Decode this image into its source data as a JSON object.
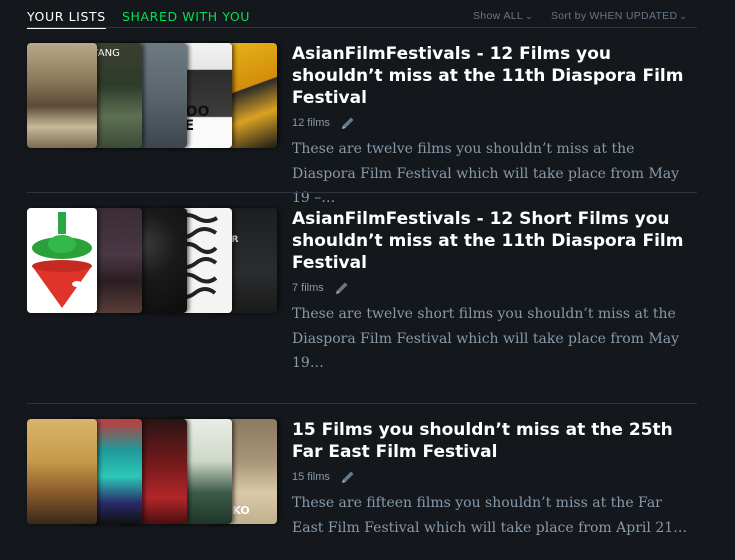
{
  "tabs": {
    "your_lists": "YOUR LISTS",
    "shared": "SHARED WITH YOU"
  },
  "filters": {
    "show_label": "Show",
    "show_value": "ALL",
    "sort_label": "Sort by",
    "sort_value": "WHEN UPDATED"
  },
  "lists": [
    {
      "title": "AsianFilmFestivals - 12 Films you shouldn’t miss at the 11th Diaspora Film Festival",
      "count": "12 films",
      "description": "These are twelve films you shouldn’t miss at the Diaspora Film Festival which will take place from May 19 –…",
      "poster_texts": [
        "",
        "ER YANG",
        "",
        "ESOO LEE",
        ""
      ]
    },
    {
      "title": "AsianFilmFestivals - 12 Short Films you shouldn’t miss at the 11th Diaspora Film Festival",
      "count": "7 films",
      "description": "These are twelve short films you shouldn’t miss at the Diaspora Film Festival which will take place from May 19…",
      "poster_texts": [
        "",
        "",
        "",
        "",
        "RDER"
      ]
    },
    {
      "title": "15 Films you shouldn’t miss at the 25th Far East Film Festival",
      "count": "15 films",
      "description": "These are fifteen films you shouldn’t miss at the Far East Film Festival which will take place from April 21…",
      "poster_texts": [
        "",
        "",
        "",
        "",
        "CHIKO"
      ]
    }
  ],
  "colors": {
    "background": "#14181c",
    "accent_green": "#00e054",
    "title": "#ffffff",
    "muted": "#8899aa"
  }
}
